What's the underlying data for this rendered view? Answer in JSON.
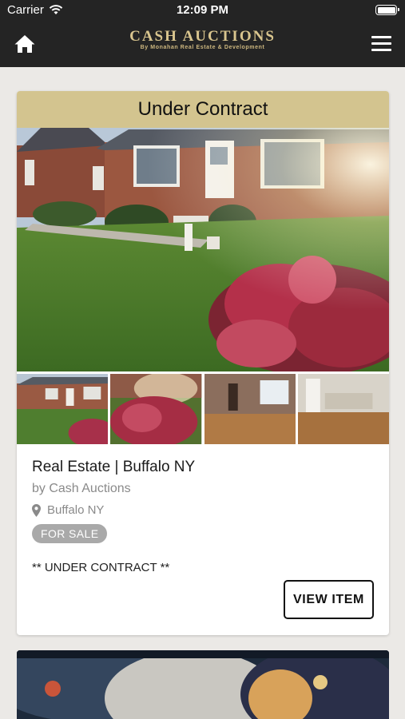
{
  "status_bar": {
    "carrier": "Carrier",
    "time": "12:09 PM"
  },
  "header": {
    "logo_title": "CASH AUCTIONS",
    "logo_subtitle": "By Monahan Real Estate & Development",
    "icons": {
      "home": "home-icon",
      "menu": "hamburger-menu-icon"
    }
  },
  "listing": {
    "status_banner": "Under Contract",
    "title": "Real Estate | Buffalo NY",
    "seller": "by Cash Auctions",
    "location": "Buffalo NY",
    "badge": "FOR SALE",
    "note": "** UNDER CONTRACT **",
    "action_label": "VIEW ITEM",
    "thumbnails": [
      "house-front-photo",
      "shrub-photo",
      "interior-room-photo",
      "interior-kitchen-photo"
    ]
  },
  "colors": {
    "banner": "#d3c48f",
    "header_bg": "#242424",
    "logo_gold": "#d9c58e",
    "badge_bg": "#a9a9a9"
  }
}
